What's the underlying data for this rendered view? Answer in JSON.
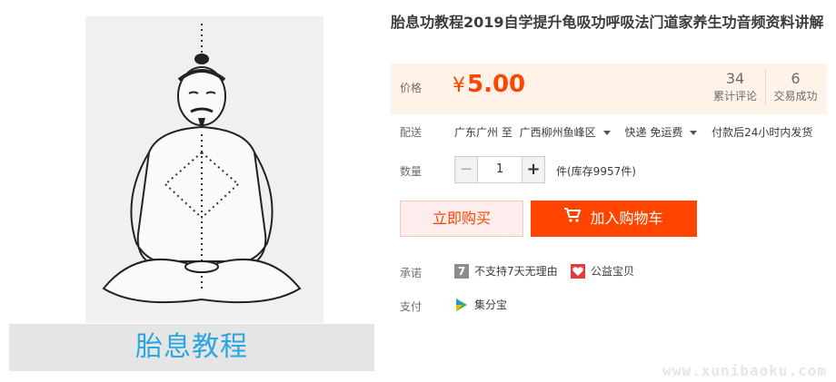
{
  "product": {
    "title": "胎息功教程2019自学提升龟吸功呼吸法门道家养生功音频资料讲解",
    "image_caption": "胎息教程"
  },
  "price": {
    "label": "价格",
    "currency": "¥",
    "value": "5.00",
    "reviews_count": "34",
    "reviews_label": "累计评论",
    "deals_count": "6",
    "deals_label": "交易成功"
  },
  "delivery": {
    "label": "配送",
    "from": "广东广州 至",
    "to": "广西柳州鱼峰区",
    "method": "快递 免运费",
    "ship_time": "付款后24小时内发货"
  },
  "quantity": {
    "label": "数量",
    "value": "1",
    "minus": "−",
    "plus": "+",
    "stock_text": "件(库存9957件)"
  },
  "actions": {
    "buy_now": "立即购买",
    "add_to_cart": "加入购物车"
  },
  "promise": {
    "label": "承诺",
    "items": [
      {
        "icon": "seven-day-icon",
        "icon_text": "7",
        "text": "不支持7天无理由"
      },
      {
        "icon": "charity-icon",
        "text": "公益宝贝"
      }
    ]
  },
  "payment": {
    "label": "支付",
    "method": "集分宝"
  },
  "watermark": "www.xunibaoku.com",
  "colors": {
    "price": "#ff4400",
    "price_panel_bg": "#fff2e8",
    "caption_text": "#29a7e0"
  }
}
